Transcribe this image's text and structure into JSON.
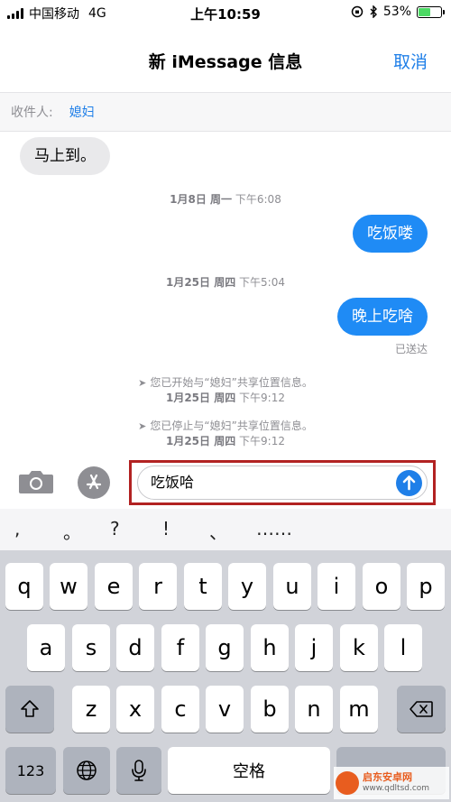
{
  "status_bar": {
    "carrier": "中国移动",
    "network": "4G",
    "time": "上午10:59",
    "battery_percent": "53%",
    "battery_level": 0.53
  },
  "nav": {
    "title": "新 iMessage 信息",
    "cancel_label": "取消"
  },
  "recipient": {
    "label": "收件人:",
    "name": "媳妇"
  },
  "messages": {
    "received_1": "马上到。",
    "ts_1_date": "1月8日 周一",
    "ts_1_time": "下午6:08",
    "sent_1": "吃饭喽",
    "ts_2_date": "1月25日 周四",
    "ts_2_time": "下午5:04",
    "sent_2": "晚上吃啥",
    "delivered": "已送达",
    "loc_start_text": "您已开始与“媳妇”共享位置信息。",
    "loc_start_date": "1月25日 周四",
    "loc_start_time": "下午9:12",
    "loc_stop_text": "您已停止与“媳妇”共享位置信息。",
    "loc_stop_date": "1月25日 周四",
    "loc_stop_time": "下午9:12"
  },
  "input": {
    "value": "吃饭哈"
  },
  "suggestions": [
    ",",
    "。",
    "?",
    "!",
    "、",
    "……"
  ],
  "keyboard": {
    "row1": [
      "q",
      "w",
      "e",
      "r",
      "t",
      "y",
      "u",
      "i",
      "o",
      "p"
    ],
    "row2": [
      "a",
      "s",
      "d",
      "f",
      "g",
      "h",
      "j",
      "k",
      "l"
    ],
    "row3": [
      "z",
      "x",
      "c",
      "v",
      "b",
      "n",
      "m"
    ],
    "numbers_label": "123",
    "space_label": "空格"
  },
  "icons": {
    "camera": "camera-icon",
    "apps": "app-store-icon",
    "send": "send-arrow-icon",
    "shift": "shift-icon",
    "delete": "delete-icon",
    "globe": "globe-icon",
    "mic": "microphone-icon",
    "location": "location-arrow-icon"
  },
  "watermark": {
    "brand": "启东安卓网",
    "url": "www.qdltsd.com"
  },
  "colors": {
    "accent": "#1f7fe8",
    "sent_bubble": "#1f8bf5",
    "received_bubble": "#e9e9eb",
    "highlight_border": "#b22222",
    "keyboard_bg": "#d1d3d9"
  }
}
